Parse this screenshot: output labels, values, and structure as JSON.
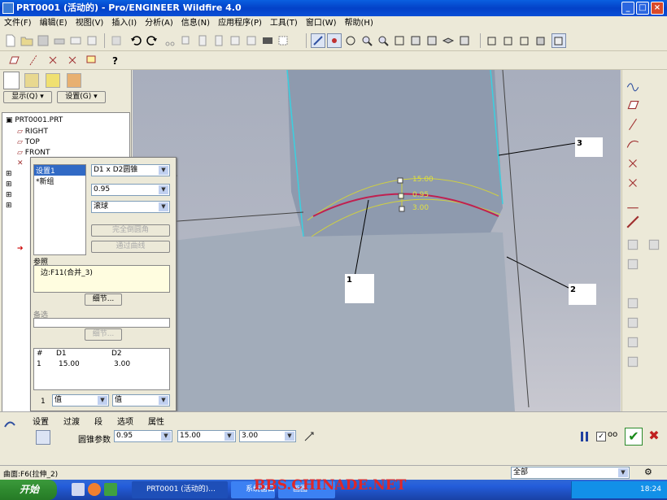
{
  "window": {
    "title": "PRT0001 (活动的) - Pro/ENGINEER Wildfire 4.0",
    "min": "_",
    "max": "□",
    "close": "×"
  },
  "menu": [
    "文件(F)",
    "编辑(E)",
    "视图(V)",
    "插入(I)",
    "分析(A)",
    "信息(N)",
    "应用程序(P)",
    "工具(T)",
    "窗口(W)",
    "帮助(H)"
  ],
  "left": {
    "show_label": "显示(Q)",
    "settings_label": "设置(G)",
    "tree": [
      "PRT0001.PRT",
      "RIGHT",
      "TOP",
      "FRONT"
    ]
  },
  "dialog": {
    "sets": [
      "设置1",
      "*新组"
    ],
    "type_select": "D1 x D2圆锥",
    "value_select": "0.95",
    "shape_select": "滚球",
    "full_round": "完全倒圆角",
    "through_curve": "通过曲线",
    "ref_label": "参照",
    "ref_value": "边:F11(合并_3)",
    "details1": "细节...",
    "alt_label": "备选",
    "details2": "细节...",
    "table_headers": [
      "#",
      "D1",
      "D2"
    ],
    "table_row": [
      "1",
      "15.00",
      "3.00"
    ],
    "row_num": "1",
    "val1": "值",
    "val2": "值"
  },
  "viewport": {
    "dims": [
      "15.00",
      "0.95",
      "3.00"
    ],
    "callouts": [
      "1",
      "2",
      "3"
    ]
  },
  "dashboard": {
    "tabs": [
      "设置",
      "过渡",
      "段",
      "选项",
      "属性"
    ],
    "cone_label": "圆锥参数",
    "cone_value": "0.95",
    "d1": "15.00",
    "d2": "3.00"
  },
  "status": {
    "text": "曲面:F6(拉伸_2)",
    "filter": "全部"
  },
  "taskbar": {
    "start": "开始",
    "tasks": [
      "PRT0001 (活动的)...",
      "系统窗口",
      "画图"
    ],
    "watermark": "BBS.CHINADE.NET",
    "clock": "18:24"
  }
}
